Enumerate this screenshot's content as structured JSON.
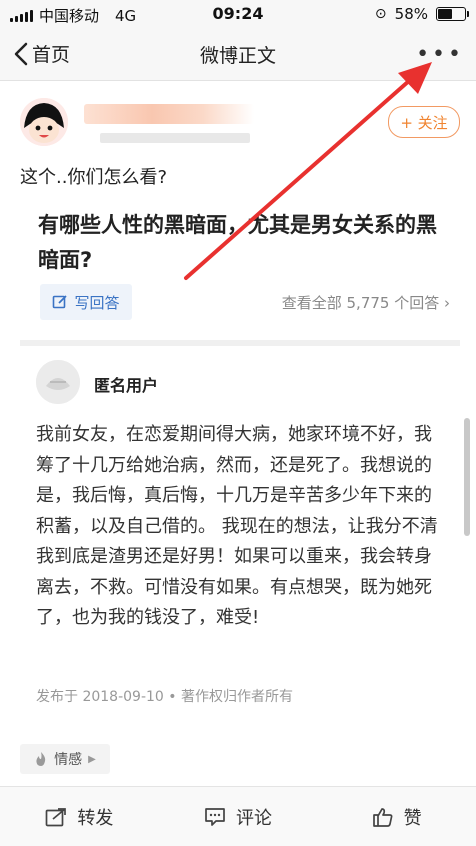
{
  "status_bar": {
    "carrier": "中国移动",
    "network": "4G",
    "time": "09:24",
    "battery": "58%",
    "battery_level": 0.58
  },
  "nav": {
    "back_label": "首页",
    "title": "微博正文"
  },
  "post": {
    "follow_label": "+ 关注",
    "text": "这个..你们怎么看?"
  },
  "question": {
    "title": "有哪些人性的黑暗面，尤其是男女关系的黑暗面?",
    "write_answer": "写回答",
    "view_all": "查看全部 5,775 个回答 ›"
  },
  "answer": {
    "author": "匿名用户",
    "body": "我前女友，在恋爱期间得大病，她家环境不好，我筹了十几万给她治病，然而，还是死了。我想说的是，我后悔，真后悔，十几万是辛苦多少年下来的积蓄，以及自己借的。 我现在的想法，让我分不清我到底是渣男还是好男！如果可以重来，我会转身离去，不救。可惜没有如果。有点想哭，既为她死了，也为我的钱没了，难受!",
    "footer": "发布于 2018-09-10 • 著作权归作者所有"
  },
  "tag": {
    "label": "情感"
  },
  "bottom_bar": {
    "repost": "转发",
    "comment": "评论",
    "like": "赞"
  },
  "colors": {
    "accent_orange": "#f08430",
    "link_blue": "#3a73c4",
    "arrow_red": "#e8312f"
  }
}
